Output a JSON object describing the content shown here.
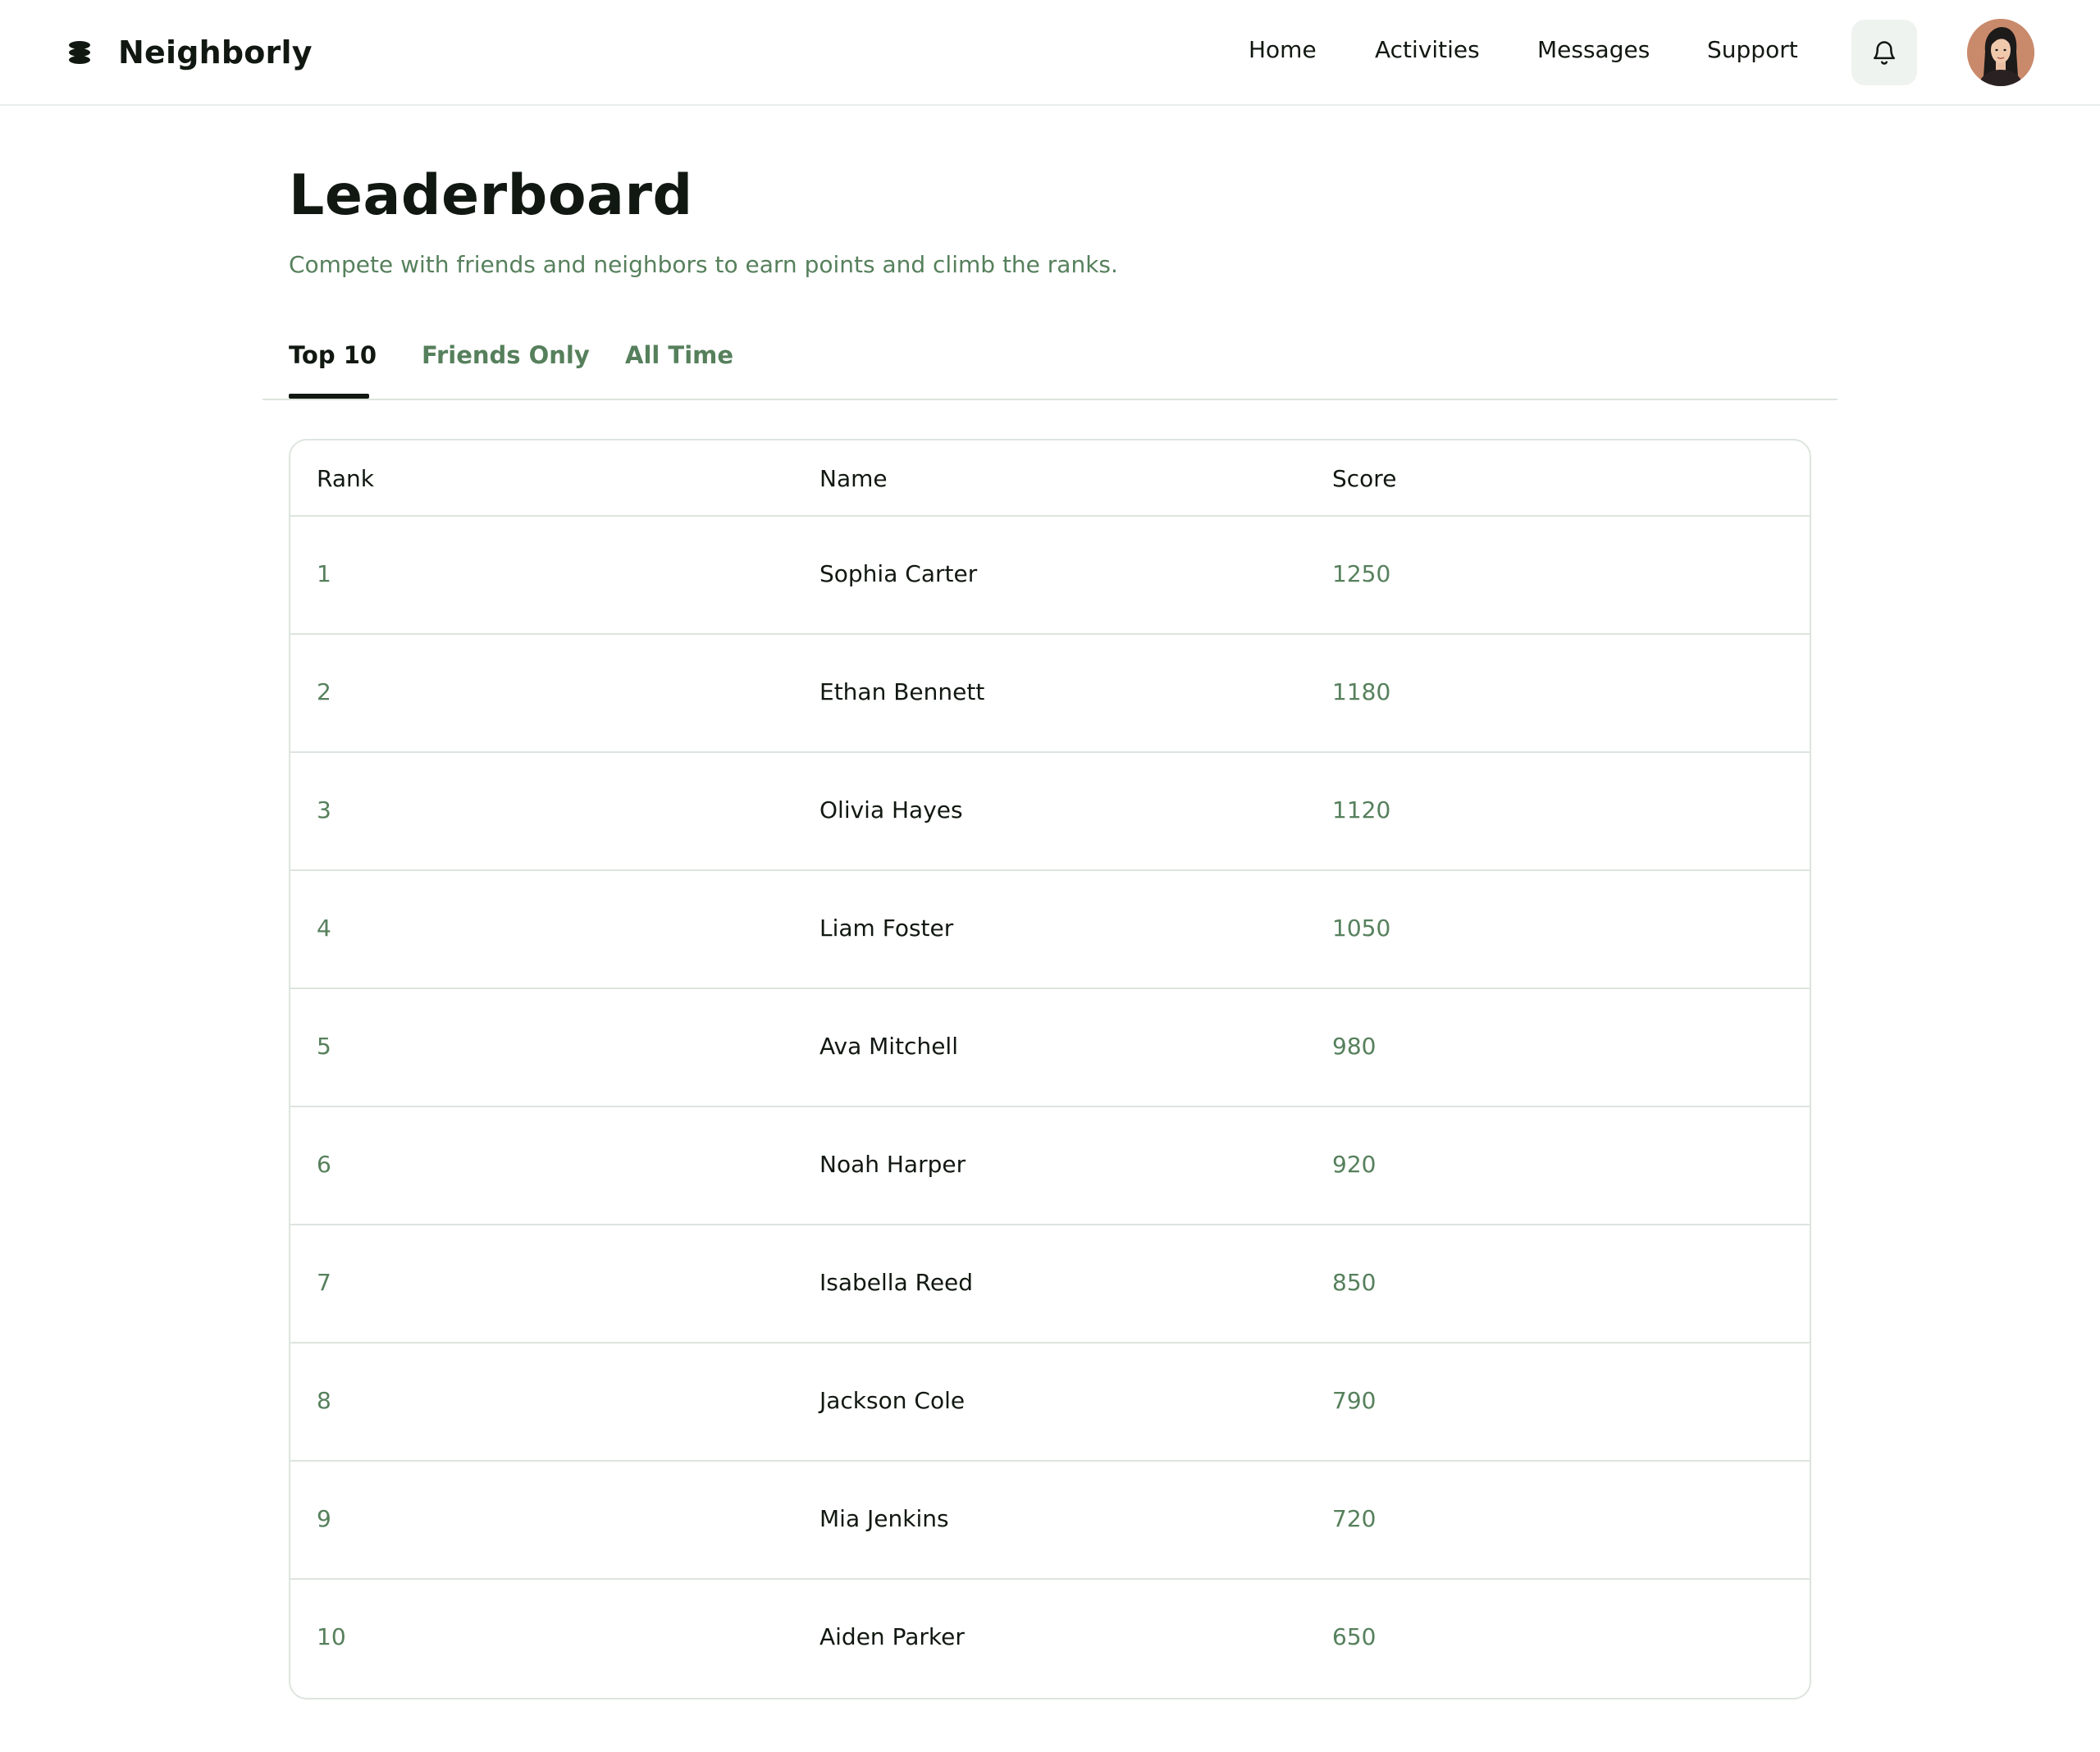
{
  "header": {
    "brand": "Neighborly",
    "nav": [
      "Home",
      "Activities",
      "Messages",
      "Support"
    ]
  },
  "page": {
    "title": "Leaderboard",
    "subtitle": "Compete with friends and neighbors to earn points and climb the ranks."
  },
  "tabs": [
    {
      "label": "Top 10",
      "active": true
    },
    {
      "label": "Friends Only",
      "active": false
    },
    {
      "label": "All Time",
      "active": false
    }
  ],
  "table": {
    "columns": [
      "Rank",
      "Name",
      "Score"
    ],
    "rows": [
      {
        "rank": "1",
        "name": "Sophia Carter",
        "score": "1250"
      },
      {
        "rank": "2",
        "name": "Ethan Bennett",
        "score": "1180"
      },
      {
        "rank": "3",
        "name": "Olivia Hayes",
        "score": "1120"
      },
      {
        "rank": "4",
        "name": "Liam Foster",
        "score": "1050"
      },
      {
        "rank": "5",
        "name": "Ava Mitchell",
        "score": "980"
      },
      {
        "rank": "6",
        "name": "Noah Harper",
        "score": "920"
      },
      {
        "rank": "7",
        "name": "Isabella Reed",
        "score": "850"
      },
      {
        "rank": "8",
        "name": "Jackson Cole",
        "score": "790"
      },
      {
        "rank": "9",
        "name": "Mia Jenkins",
        "score": "720"
      },
      {
        "rank": "10",
        "name": "Aiden Parker",
        "score": "650"
      }
    ]
  },
  "icons": {
    "brand": "stacked-layers-icon",
    "notifications": "bell-icon",
    "avatar": "user-avatar"
  },
  "colors": {
    "text": "#111811",
    "accent_green": "#56805c",
    "border": "#dde5de",
    "bell_bg": "#eff3f0"
  }
}
